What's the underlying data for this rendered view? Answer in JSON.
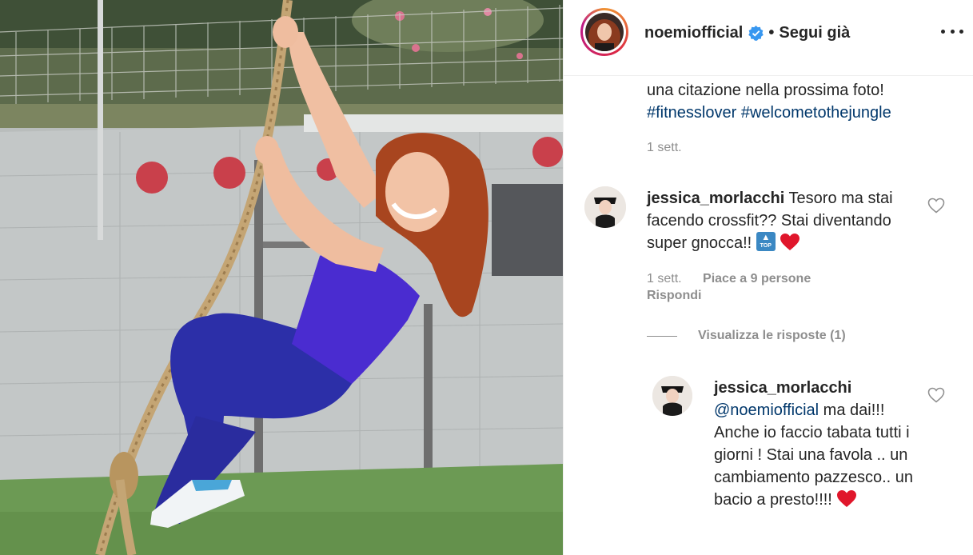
{
  "post": {
    "username": "noemiofficial",
    "verified_icon": "verified-badge-icon",
    "separator": "•",
    "follow_label": "Segui già",
    "more_icon": "more-options-icon",
    "caption_text": "una citazione nella prossima foto!",
    "hashtags": [
      "#fitnesslover",
      "#welcometothejungle"
    ],
    "time": "1 sett."
  },
  "comments": [
    {
      "username": "jessica_morlacchi",
      "text": "Tesoro ma stai facendo crossfit?? Stai diventando super gnocca!!",
      "emojis": [
        "top-arrow-emoji",
        "red-heart-emoji"
      ],
      "time": "1 sett.",
      "likes": "Piace a 9 persone",
      "reply_label": "Rispondi",
      "view_replies": "Visualizza le risposte (1)",
      "reply": {
        "username": "jessica_morlacchi",
        "mention": "@noemiofficial",
        "text": "ma dai!!! Anche io faccio tabata tutti i giorni ! Stai una favola .. un cambiamento pazzesco.. un bacio a presto!!!!",
        "emoji": "red-heart-emoji"
      }
    }
  ],
  "colors": {
    "text": "#262626",
    "secondary": "#8e8e8e",
    "link": "#00376b",
    "verified": "#3897f0",
    "heart": "#e0162b"
  }
}
